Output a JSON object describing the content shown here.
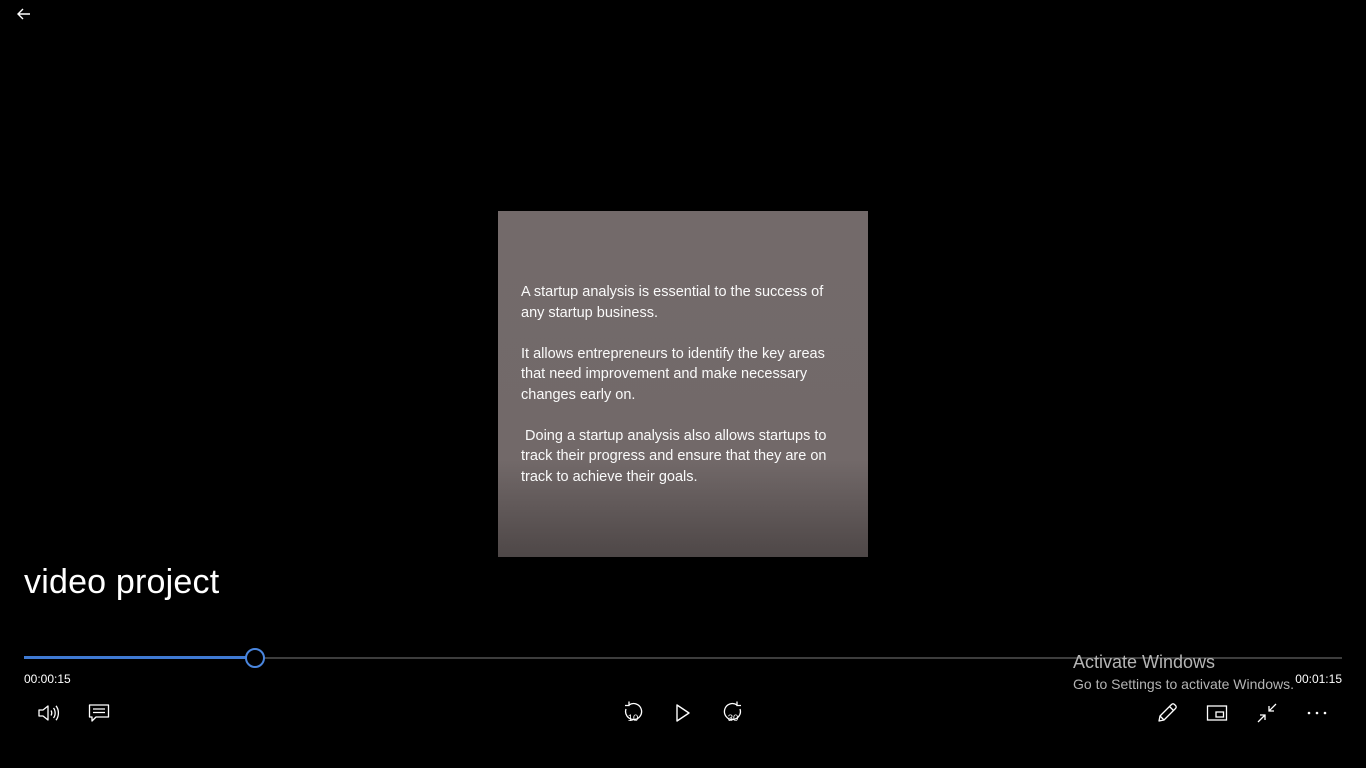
{
  "video": {
    "paragraphs": [
      "A startup analysis is essential to the success of any startup business.",
      "It allows entrepreneurs to identify the key areas that need improvement and make necessary changes early on.",
      " Doing a startup analysis also allows startups to track their progress and ensure that they are on track to achieve their goals."
    ]
  },
  "player": {
    "title": "video project",
    "elapsed": "00:00:15",
    "total": "00:01:15",
    "progress_fraction": 0.175,
    "skip_back_seconds": "10",
    "skip_forward_seconds": "30",
    "accent_color": "#3f7ad3"
  },
  "watermark": {
    "title": "Activate Windows",
    "subtitle": "Go to Settings to activate Windows."
  },
  "icons": {
    "back": "back-arrow-icon",
    "volume": "volume-icon",
    "captions": "captions-icon",
    "skip_back": "skip-back-icon",
    "play": "play-icon",
    "skip_forward": "skip-forward-icon",
    "edit": "pencil-icon",
    "mini_view": "mini-view-icon",
    "exit_fullscreen": "exit-fullscreen-icon",
    "more": "more-icon"
  }
}
